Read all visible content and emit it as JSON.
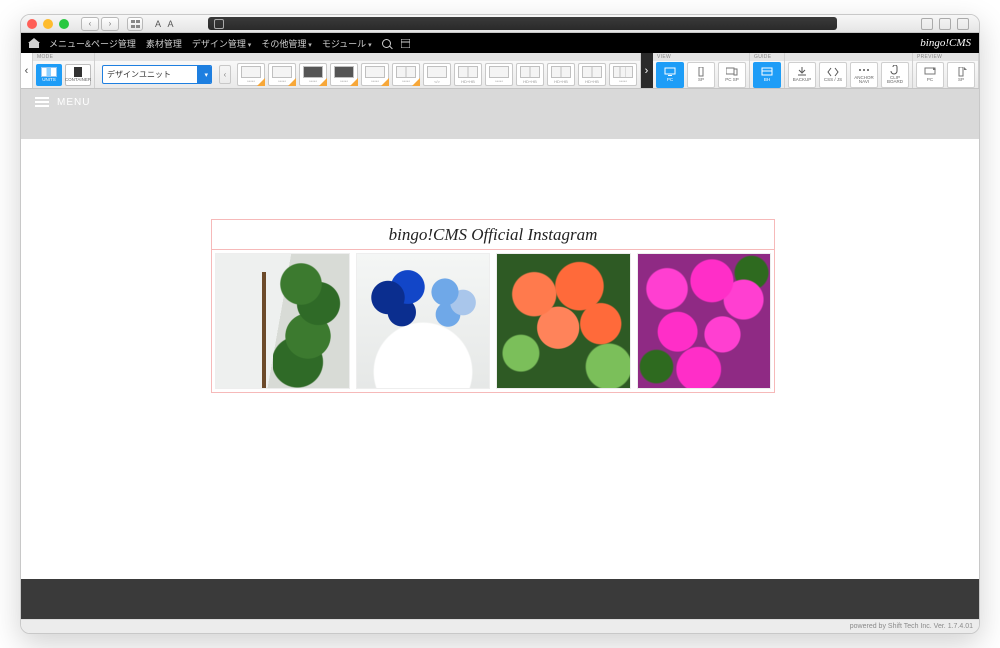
{
  "brand": "bingo!CMS",
  "menubar": {
    "items": [
      "メニュー&ページ管理",
      "素材管理",
      "デザイン管理",
      "その他管理",
      "モジュール"
    ],
    "hasDropdown": [
      false,
      false,
      true,
      true,
      true
    ]
  },
  "toolbar": {
    "mode": {
      "header": "MODE",
      "units": "UNITS",
      "container": "CONTAINER",
      "dropdown": "デザインユニット"
    },
    "units": [
      {
        "lbl": "*****",
        "corner": true
      },
      {
        "lbl": "*****",
        "corner": true
      },
      {
        "lbl": "*****",
        "corner": true,
        "variant": "dark"
      },
      {
        "lbl": "*****",
        "corner": true,
        "variant": "dark"
      },
      {
        "lbl": "*****",
        "corner": true
      },
      {
        "lbl": "*****",
        "corner": true,
        "variant": "split2"
      },
      {
        "lbl": "</>",
        "corner": false
      },
      {
        "lbl": "HD+HB",
        "corner": false,
        "variant": "split2"
      },
      {
        "lbl": "*****",
        "corner": false
      },
      {
        "lbl": "HD+HB",
        "corner": false,
        "variant": "split2"
      },
      {
        "lbl": "HD+HB",
        "corner": false,
        "variant": "split2"
      },
      {
        "lbl": "HD+HB",
        "corner": false,
        "variant": "split2"
      },
      {
        "lbl": "*****",
        "corner": false,
        "variant": "split3"
      }
    ],
    "view": {
      "header": "VIEW",
      "pc": "PC",
      "sp": "SP",
      "pcsp": "PC SP"
    },
    "guide": {
      "header": "GUIDE",
      "bh": "BH"
    },
    "actions": {
      "backup": "BACKUP",
      "cssjs": "CSS / JS",
      "anchor": "ANCHOR\nNAVI",
      "clip": "CLIP\nBOARD"
    },
    "preview": {
      "header": "PREVIEW",
      "pc": "PC",
      "sp": "SP"
    }
  },
  "menuButton": "MENU",
  "instagram": {
    "title": "bingo!CMS Official Instagram"
  },
  "footer": "powered by Shift Tech Inc. Ver. 1.7.4.01"
}
